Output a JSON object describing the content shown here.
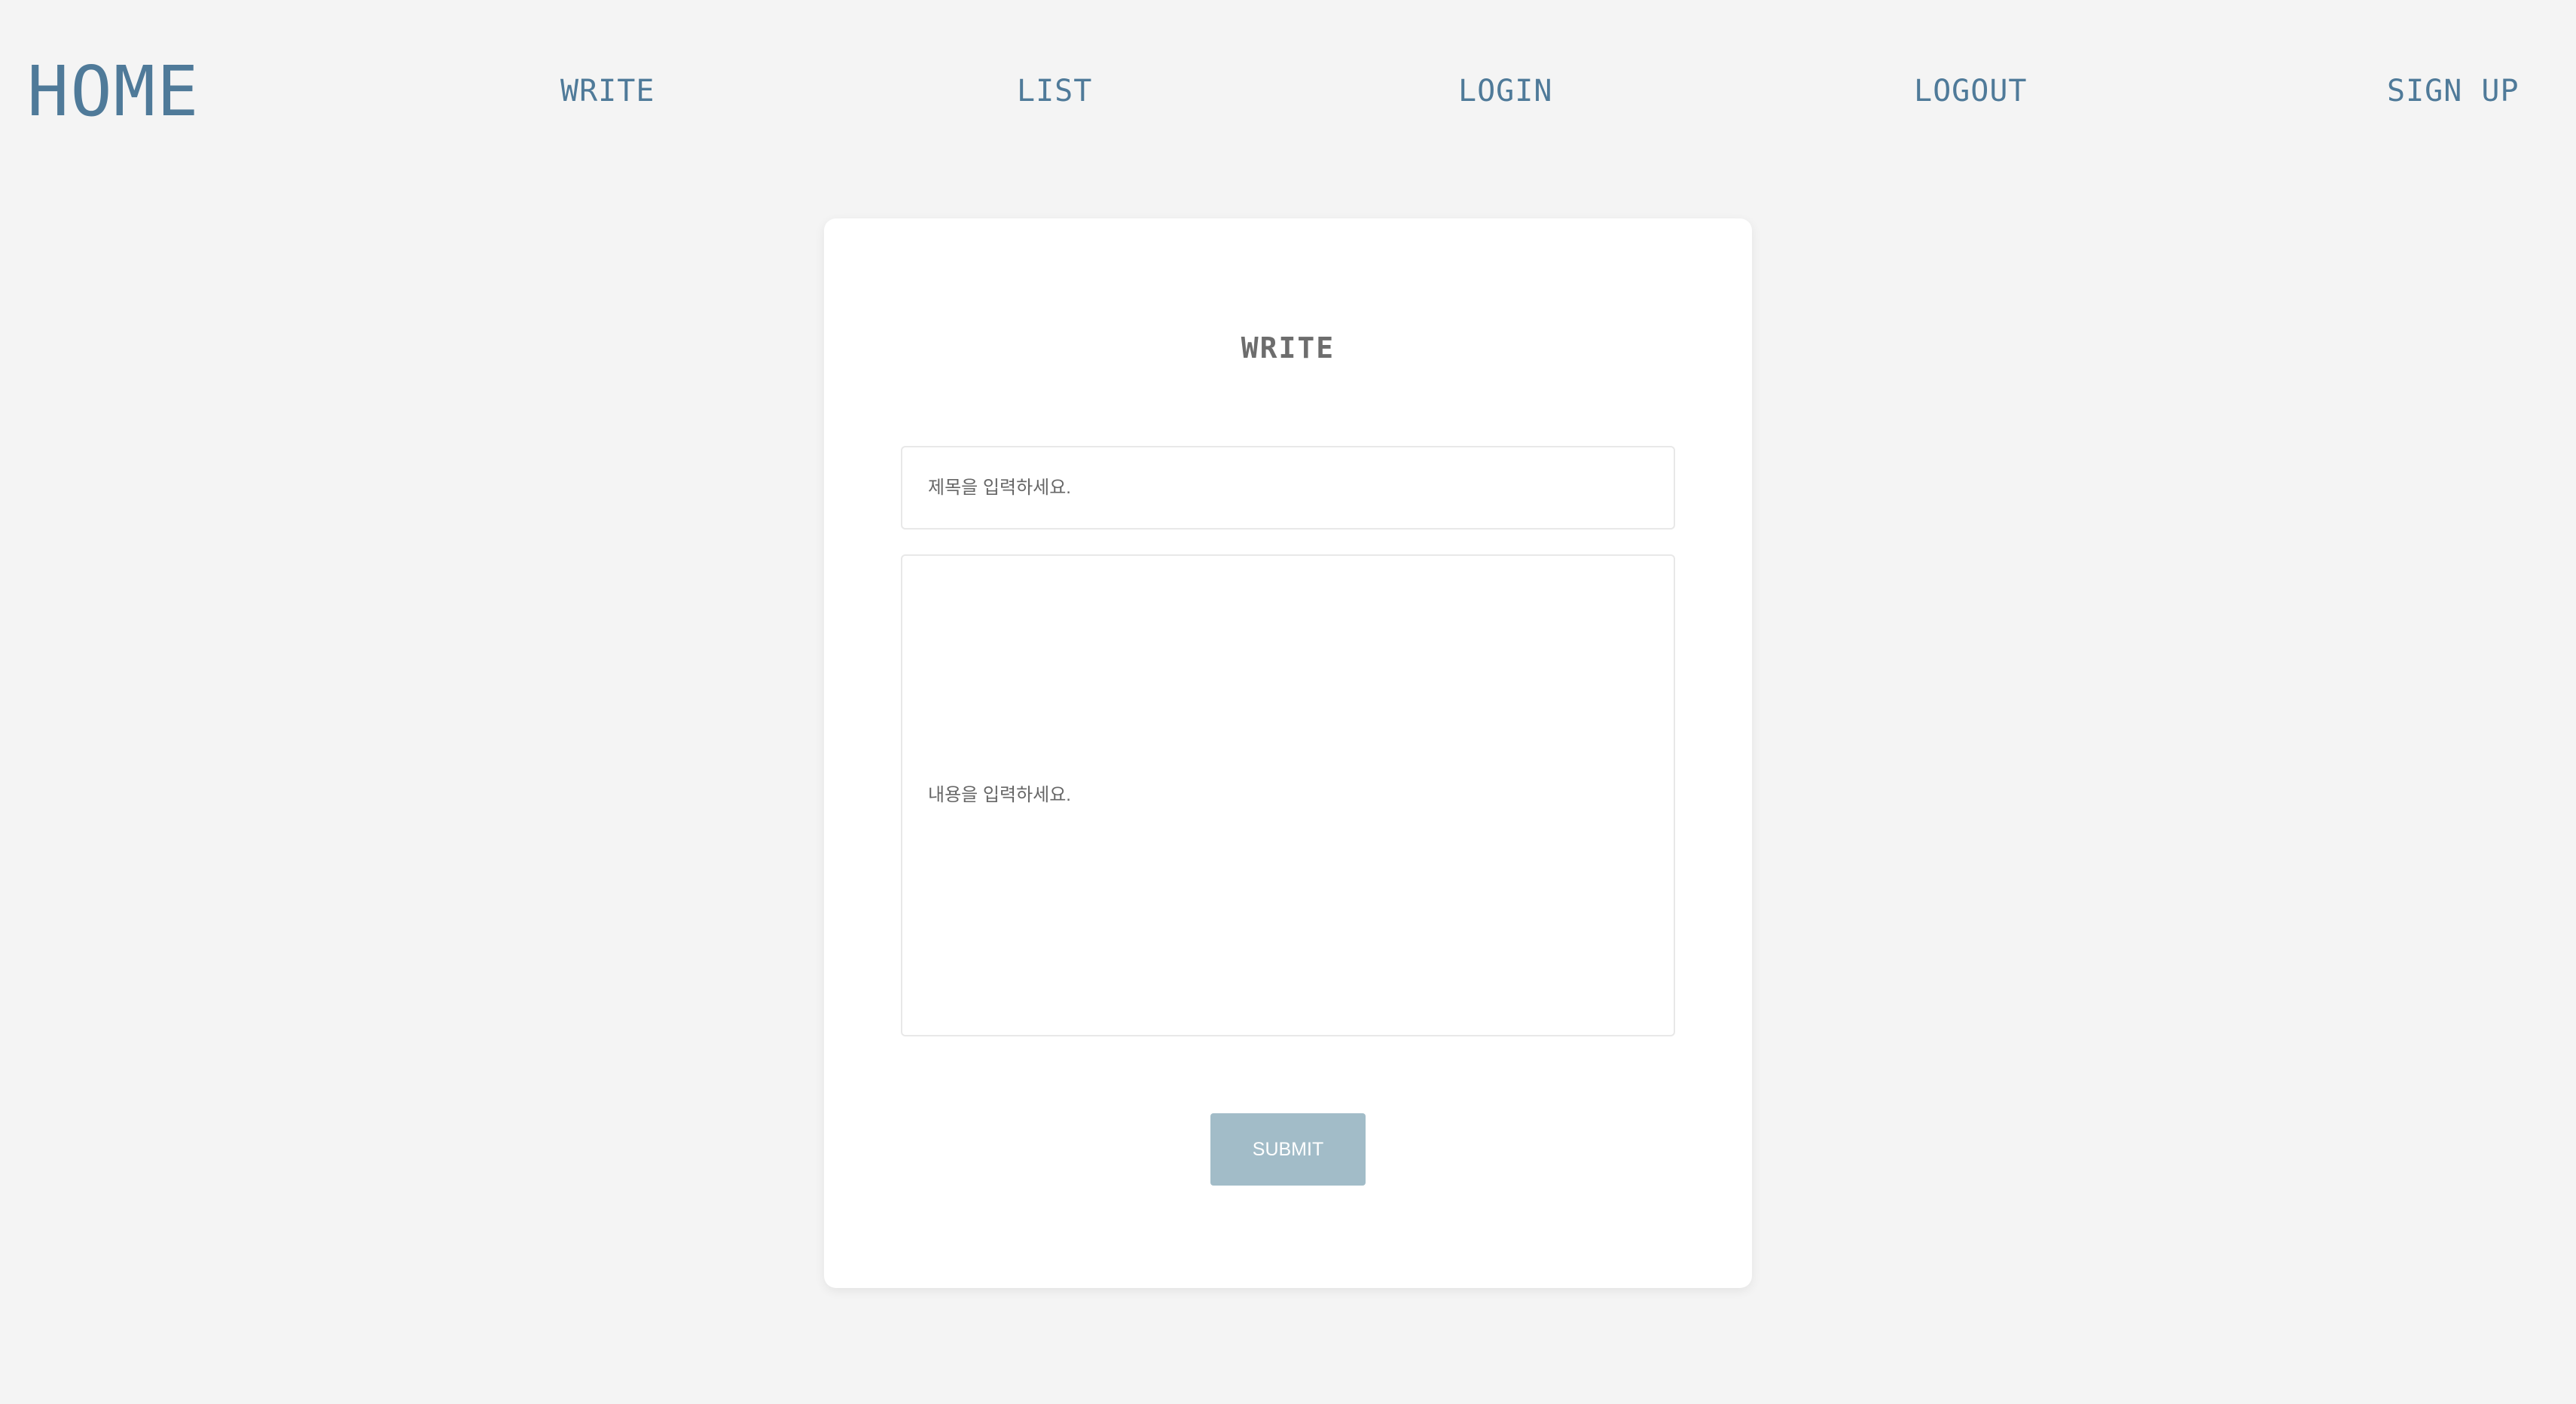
{
  "nav": {
    "home": "HOME",
    "write": "WRITE",
    "list": "LIST",
    "login": "LOGIN",
    "logout": "LOGOUT",
    "signup": "SIGN UP"
  },
  "form": {
    "title": "WRITE",
    "title_placeholder": "제목을 입력하세요.",
    "content_placeholder": "내용을 입력하세요.",
    "submit_label": "SUBMIT"
  },
  "colors": {
    "background": "#f4f4f4",
    "nav_text": "#4f7a99",
    "card": "#ffffff",
    "heading": "#6d6d6d",
    "submit": "#a2bcc8"
  }
}
